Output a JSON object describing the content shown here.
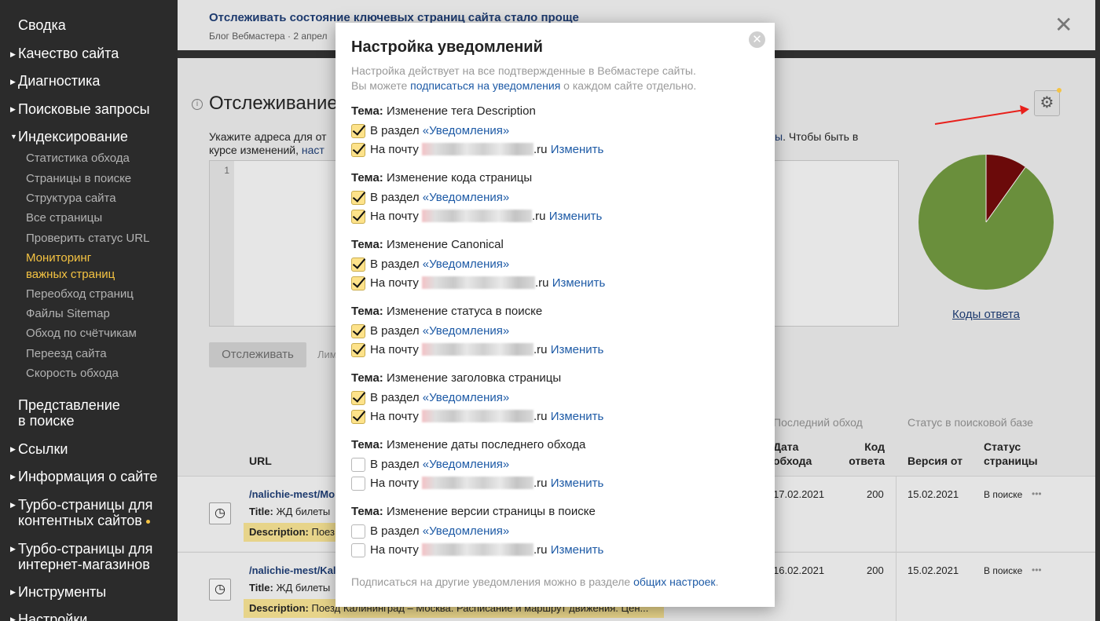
{
  "sidebar": {
    "top_label": "Сводка",
    "sections": [
      {
        "label": "Качество сайта"
      },
      {
        "label": "Диагностика"
      },
      {
        "label": "Поисковые запросы"
      },
      {
        "label": "Индексирование"
      }
    ],
    "indexing_items": [
      "Статистика обхода",
      "Страницы в поиске",
      "Структура сайта",
      "Все страницы",
      "Проверить статус URL",
      "Мониторинг",
      "важных страниц",
      "Переобход страниц",
      "Файлы Sitemap",
      "Обход по счётчикам",
      "Переезд сайта",
      "Скорость обхода"
    ],
    "presentation_line1": "Представление",
    "presentation_line2": "в поиске",
    "sections2": [
      "Ссылки",
      "Информация о сайте",
      "Турбо-страницы для",
      "контентных сайтов",
      "Турбо-страницы для",
      "интернет-магазинов",
      "Инструменты",
      "Настройки"
    ]
  },
  "news": {
    "title": "Отслеживать состояние ключевых страниц сайта стало проще",
    "subtitle": "Блог Вебмастера · 2 апрел",
    "close_glyph": "✕"
  },
  "page": {
    "title": "Отслеживание",
    "intro_line1": "Укажите адреса для от",
    "intro_line2_a": "курсе изменений, ",
    "intro_line2_b": "наст",
    "intro_right_link": "ы",
    "intro_right_text": ". Чтобы быть в",
    "editor_line": "1",
    "track_button": "Отслеживать",
    "limit_text": "Лим",
    "pie_caption": "Коды ответа",
    "pie_colors": {
      "ok": "#6a8f3c",
      "other": "#6b0a0a"
    }
  },
  "table": {
    "group_last_crawl": "Последний обход",
    "group_status": "Статус в поисковой базе",
    "headers": {
      "url": "URL",
      "date_line1": "Дата",
      "date_line2": "обхода",
      "code_line1": "Код",
      "code_line2": "ответа",
      "version": "Версия от",
      "status_line1": "Статус",
      "status_line2": "страницы"
    },
    "rows": [
      {
        "url": "/nalichie-mest/Mo",
        "title_label": "Title:",
        "title": "ЖД билеты",
        "desc_label": "Description:",
        "desc": "Поез",
        "date": "17.02.2021",
        "code": "200",
        "version": "15.02.2021",
        "status": "В поиске",
        "more": "•••"
      },
      {
        "url": "/nalichie-mest/Kal",
        "title_label": "Title:",
        "title": "ЖД билеты",
        "desc_label": "Description:",
        "desc": "Поезд Калининград – Москва. Расписание и маршрут движения. Цен...",
        "date": "16.02.2021",
        "code": "200",
        "version": "15.02.2021",
        "status": "В поиске",
        "more": "•••"
      }
    ]
  },
  "modal": {
    "title": "Настройка уведомлений",
    "desc_line1": "Настройка действует на все подтвержденные в Вебмастере сайты.",
    "desc_line2_a": "Вы можете ",
    "desc_line2_link": "подписаться на уведомления",
    "desc_line2_b": " о каждом сайте отдельно.",
    "topic_label": "Тема:",
    "section_prefix": "В раздел ",
    "section_link": "«Уведомления»",
    "email_prefix": "На почту ",
    "email_suffix": ".ru",
    "change_link": "Изменить",
    "topics": [
      {
        "name": "Изменение тега Description",
        "section_on": true,
        "email_on": true
      },
      {
        "name": "Изменение кода страницы",
        "section_on": true,
        "email_on": true
      },
      {
        "name": "Изменение Canonical",
        "section_on": true,
        "email_on": true
      },
      {
        "name": "Изменение статуса в поиске",
        "section_on": true,
        "email_on": true
      },
      {
        "name": "Изменение заголовка страницы",
        "section_on": true,
        "email_on": true
      },
      {
        "name": "Изменение даты последнего обхода",
        "section_on": false,
        "email_on": false
      },
      {
        "name": "Изменение версии страницы в поиске",
        "section_on": false,
        "email_on": false
      }
    ],
    "footer_text": "Подписаться на другие уведомления можно в разделе ",
    "footer_link": "общих настроек",
    "footer_end": ".",
    "close_glyph": "✕"
  }
}
